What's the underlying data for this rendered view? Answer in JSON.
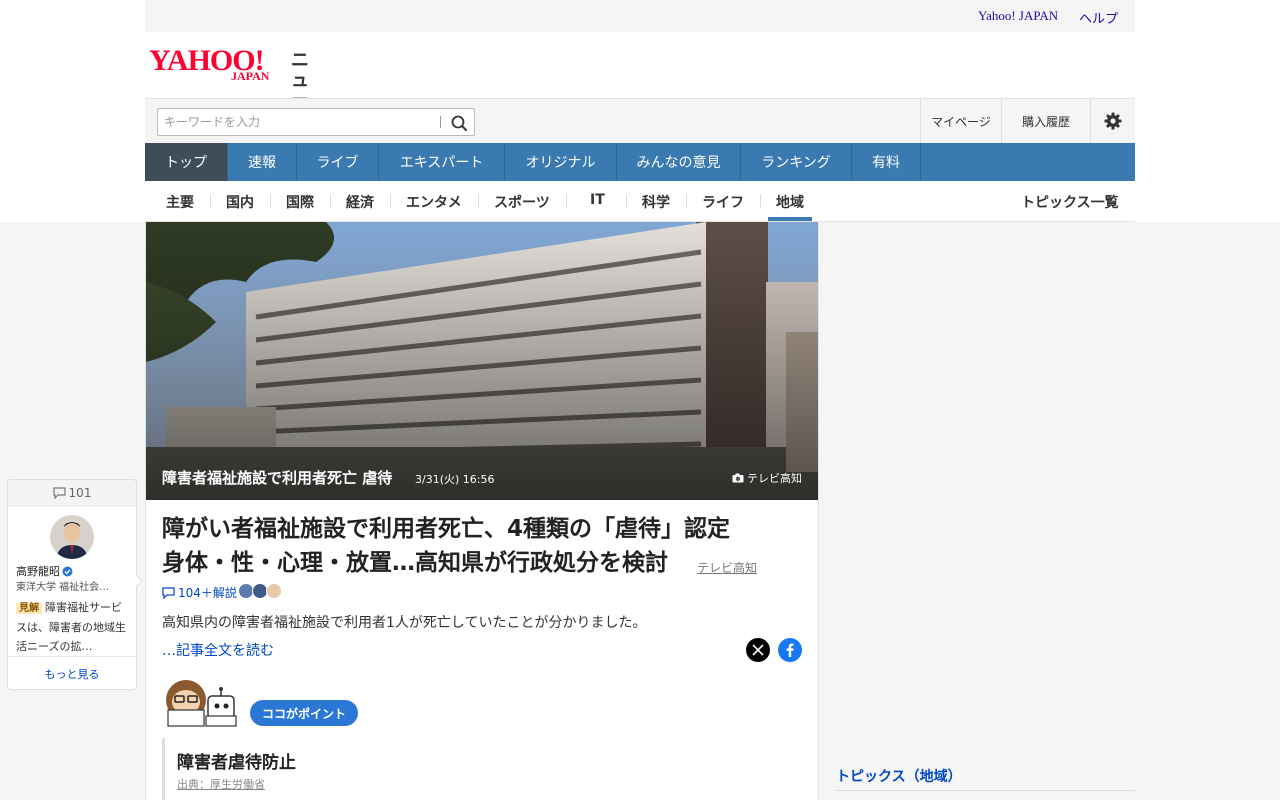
{
  "util": {
    "yahoo_japan": "Yahoo! JAPAN",
    "help": "ヘルプ"
  },
  "logo": {
    "brand": "YAHOO!",
    "sub": "JAPAN",
    "service": "ニュース",
    "color": "#ff0033"
  },
  "search": {
    "placeholder": "キーワードを入力",
    "value": ""
  },
  "tools": {
    "mypage": "マイページ",
    "history": "購入履歴"
  },
  "nav": [
    "トップ",
    "速報",
    "ライブ",
    "エキスパート",
    "オリジナル",
    "みんなの意見",
    "ランキング",
    "有料"
  ],
  "subnav": [
    "主要",
    "国内",
    "国際",
    "経済",
    "エンタメ",
    "スポーツ",
    "IT",
    "科学",
    "ライフ",
    "地域"
  ],
  "subnav_active": "地域",
  "topics_list": "トピックス一覧",
  "photo": {
    "caption": "障害者福祉施設で利用者死亡 虐待",
    "date": "3/31(火) 16:56",
    "credit": "テレビ高知"
  },
  "article": {
    "headline_line1": "障がい者福祉施設で利用者死亡、4種類の「虐待」認定",
    "headline_line2": "身体・性・心理・放置…高知県が行政処分を検討",
    "source": "テレビ高知",
    "comments": "104＋解説",
    "summary": "高知県内の障害者福祉施設で利用者1人が死亡していたことが分かりました。",
    "read_more": "…記事全文を読む"
  },
  "point": {
    "badge": "ココがポイント",
    "title": "障害者虐待防止",
    "source": "出典：厚生労働省"
  },
  "expert": {
    "count": "101",
    "name": "高野龍昭",
    "role": "東洋大学 福祉社会…",
    "tag": "見解",
    "text": "障害福祉サービスは、障害者の地域生活ニーズの拡…",
    "more": "もっと見る"
  },
  "topics": {
    "title": "トピックス（地域）"
  },
  "colors": {
    "nav_bg": "#3b7ab0",
    "nav_active": "#3f4d5a",
    "link": "#0047c8",
    "badge": "#2b77d6"
  }
}
